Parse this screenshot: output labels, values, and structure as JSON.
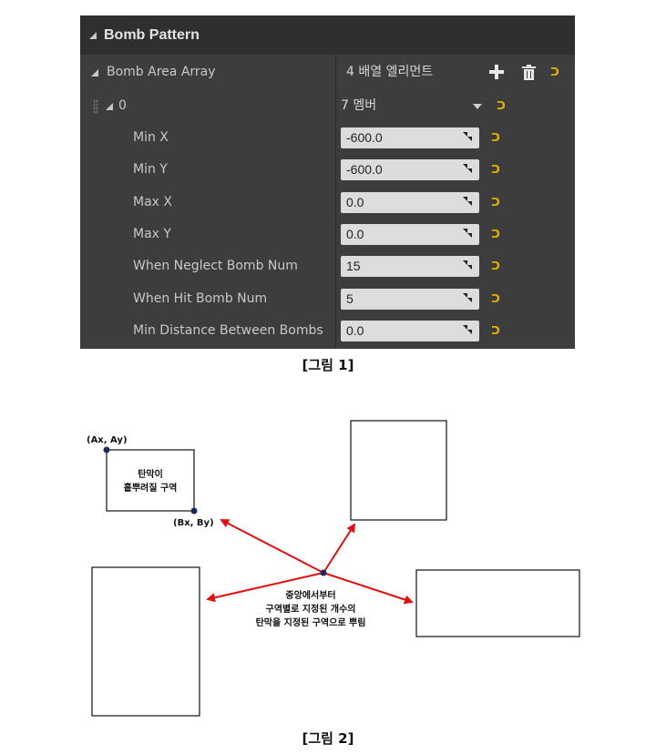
{
  "details_panel": {
    "category_title": "Bomb Pattern",
    "array_label": "Bomb Area Array",
    "array_value": "4 배열 엘리먼트",
    "element_index": "0",
    "element_value": "7 멤버",
    "fields": [
      {
        "label": "Min X",
        "value": "-600.0"
      },
      {
        "label": "Min Y",
        "value": "-600.0"
      },
      {
        "label": "Max X",
        "value": "0.0"
      },
      {
        "label": "Max Y",
        "value": "0.0"
      },
      {
        "label": "When Neglect Bomb Num",
        "value": "15"
      },
      {
        "label": "When Hit Bomb Num",
        "value": "5"
      },
      {
        "label": "Min Distance Between Bombs",
        "value": "0.0"
      }
    ],
    "reset_icon": "reset-arrow-icon",
    "accent_color": "#e2b100"
  },
  "caption1": "[그림 1]",
  "caption2": "[그림 2]",
  "diagram": {
    "corner_a": "(Ax, Ay)",
    "corner_b": "(Bx, By)",
    "area_line1": "탄막이",
    "area_line2": "흩뿌려질 구역",
    "center_line1": "중앙에서부터",
    "center_line2": "구역별로 지정된 개수의",
    "center_line3": "탄막을 지정된 구역으로 뿌림",
    "arrow_color": "#e01010",
    "point_color": "#1a2a5a"
  }
}
